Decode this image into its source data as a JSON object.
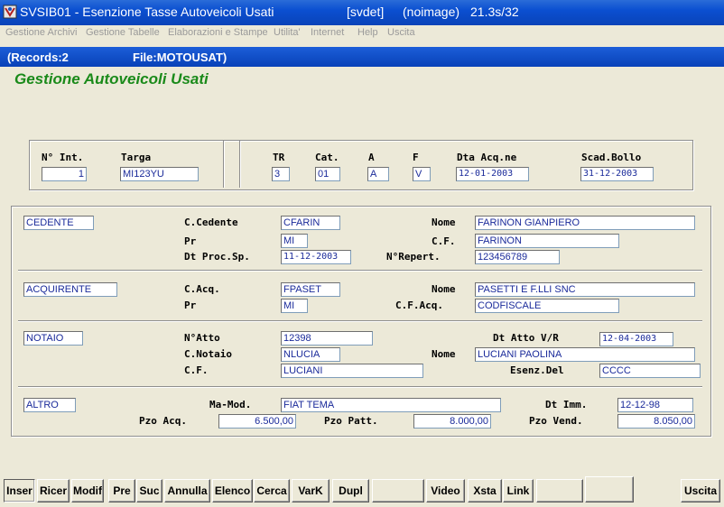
{
  "titlebar": {
    "app": "SVSIB01 - Esenzione Tasse Autoveicoli Usati",
    "server": "[svdet]",
    "image": "(noimage)",
    "version": "21.3s/32"
  },
  "menu": [
    "Gestione Archivi",
    "Gestione Tabelle",
    "Elaborazioni e Stampe",
    "Utilita'",
    "Internet",
    "Help",
    "Uscita"
  ],
  "status": {
    "records": "(Records:2",
    "file": "File:MOTOUSAT)"
  },
  "page_title": "Gestione Autoveicoli Usati",
  "header": {
    "labels": {
      "nint": "N° Int.",
      "targa": "Targa",
      "tr": "TR",
      "cat": "Cat.",
      "a": "A",
      "f": "F",
      "dta": "Dta Acq.ne",
      "scad": "Scad.Bollo"
    },
    "values": {
      "nint": "1",
      "targa": "MI123YU",
      "tr": "3",
      "cat": "01",
      "a": "A",
      "f": "V",
      "dta": "12-01-2003",
      "scad": "31-12-2003"
    }
  },
  "cedente": {
    "section": "CEDENTE",
    "labels": {
      "code": "C.Cedente",
      "nome": "Nome",
      "pr": "Pr",
      "cf": "C.F.",
      "dtproc": "Dt Proc.Sp.",
      "nrep": "N°Repert."
    },
    "values": {
      "code": "CFARIN",
      "nome": "FARINON GIANPIERO",
      "pr": "MI",
      "cf": "FARINON",
      "dtproc": "11-12-2003",
      "nrep": "123456789"
    }
  },
  "acquirente": {
    "section": "ACQUIRENTE",
    "labels": {
      "code": "C.Acq.",
      "nome": "Nome",
      "pr": "Pr",
      "cf": "C.F.Acq."
    },
    "values": {
      "code": "FPASET",
      "nome": "PASETTI E F.LLI SNC",
      "pr": "MI",
      "cf": "CODFISCALE"
    }
  },
  "notaio": {
    "section": "NOTAIO",
    "labels": {
      "atto": "N°Atto",
      "dtatto": "Dt Atto V/R",
      "code": "C.Notaio",
      "nome": "Nome",
      "cf": "C.F.",
      "esenz": "Esenz.Del"
    },
    "values": {
      "atto": "12398",
      "dtatto": "12-04-2003",
      "code": "NLUCIA",
      "nome": "LUCIANI PAOLINA",
      "cf": "LUCIANI",
      "esenz": "CCCC"
    }
  },
  "altro": {
    "section": "ALTRO",
    "labels": {
      "mamod": "Ma-Mod.",
      "dtimm": "Dt Imm.",
      "pzoacq": "Pzo Acq.",
      "pzopatt": "Pzo Patt.",
      "pzovend": "Pzo Vend."
    },
    "values": {
      "mamod": "FIAT TEMA",
      "dtimm": "12-12-98",
      "pzoacq": "6.500,00",
      "pzopatt": "8.000,00",
      "pzovend": "8.050,00"
    }
  },
  "buttons": [
    "Inser",
    "Ricer",
    "Modif",
    "Pre",
    "Suc",
    "Annulla",
    "Elenco",
    "Cerca",
    "VarK",
    "Dupl",
    "",
    "Video",
    "Xsta",
    "Link",
    "",
    "",
    "Uscita"
  ]
}
